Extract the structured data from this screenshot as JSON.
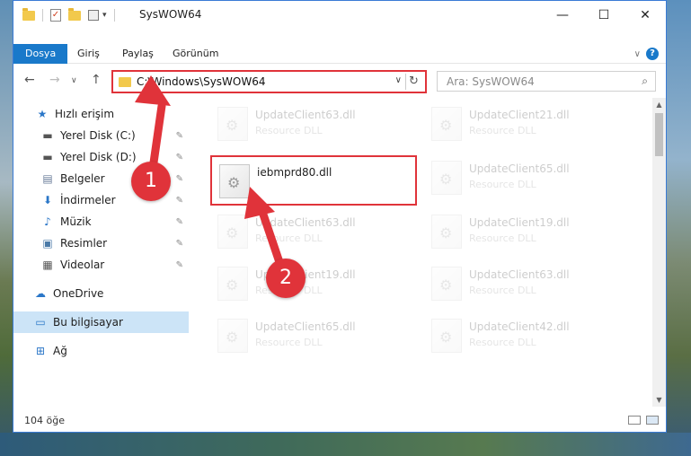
{
  "window": {
    "title": "SysWOW64",
    "minimize": "—",
    "maximize": "☐",
    "close": "✕"
  },
  "ribbon": {
    "tabs": [
      {
        "label": "Dosya",
        "active": true
      },
      {
        "label": "Giriş"
      },
      {
        "label": "Paylaş"
      },
      {
        "label": "Görünüm"
      }
    ],
    "chevron": "∨",
    "help": "?"
  },
  "navigation": {
    "back": "←",
    "forward": "→",
    "recent": "∨",
    "up": "↑",
    "address": "C:\\Windows\\SysWOW64",
    "address_dropdown": "∨",
    "refresh": "↻",
    "search_placeholder": "Ara: SysWOW64",
    "search_icon": "⌕"
  },
  "sidebar": {
    "items": [
      {
        "label": "Hızlı erişim",
        "icon": "star-icon",
        "glyph": "★",
        "pinned": false
      },
      {
        "label": "Yerel Disk (C:)",
        "icon": "drive-icon",
        "glyph": "▬",
        "pinned": true
      },
      {
        "label": "Yerel Disk (D:)",
        "icon": "drive-icon",
        "glyph": "▬",
        "pinned": true
      },
      {
        "label": "Belgeler",
        "icon": "documents-icon",
        "glyph": "▤",
        "pinned": true
      },
      {
        "label": "İndirmeler",
        "icon": "download-icon",
        "glyph": "⬇",
        "pinned": true
      },
      {
        "label": "Müzik",
        "icon": "music-icon",
        "glyph": "♪",
        "pinned": true
      },
      {
        "label": "Resimler",
        "icon": "pictures-icon",
        "glyph": "▣",
        "pinned": true
      },
      {
        "label": "Videolar",
        "icon": "videos-icon",
        "glyph": "▦",
        "pinned": true
      },
      {
        "label": "OneDrive",
        "icon": "cloud-icon",
        "glyph": "☁",
        "pinned": false
      },
      {
        "label": "Bu bilgisayar",
        "icon": "computer-icon",
        "glyph": "▭",
        "pinned": false,
        "selected": true
      },
      {
        "label": "Ağ",
        "icon": "network-icon",
        "glyph": "⊞",
        "pinned": false
      }
    ],
    "pin_glyph": "📌"
  },
  "files": {
    "left_column": [
      {
        "name": "UpdateClient63.dll",
        "type": "Resource DLL",
        "faded": true
      },
      {
        "name": "iebmprd80.dll",
        "type": "",
        "highlight": true
      },
      {
        "name": "UpdateClient63.dll",
        "type": "Resource DLL",
        "faded": true
      },
      {
        "name": "UpdateClient19.dll",
        "type": "Resource DLL",
        "faded": true
      },
      {
        "name": "UpdateClient65.dll",
        "type": "Resource DLL",
        "faded": true
      }
    ],
    "right_column": [
      {
        "name": "UpdateClient21.dll",
        "type": "Resource DLL",
        "faded": true
      },
      {
        "name": "UpdateClient65.dll",
        "type": "Resource DLL",
        "faded": true
      },
      {
        "name": "UpdateClient19.dll",
        "type": "Resource DLL",
        "faded": true
      },
      {
        "name": "UpdateClient63.dll",
        "type": "Resource DLL",
        "faded": true
      },
      {
        "name": "UpdateClient42.dll",
        "type": "Resource DLL",
        "faded": true
      }
    ]
  },
  "status": {
    "item_count": "104 öğe"
  },
  "annotations": {
    "step1": "1",
    "step2": "2",
    "color": "#e0333a"
  }
}
